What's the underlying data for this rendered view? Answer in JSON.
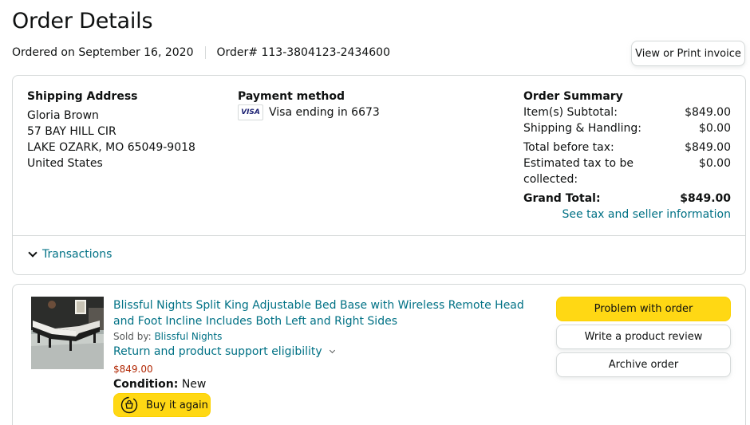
{
  "page": {
    "title": "Order Details",
    "ordered_on": "Ordered on September 16, 2020",
    "order_number": "Order# 113-3804123-2434600",
    "invoice_button": "View or Print invoice"
  },
  "shipping": {
    "title": "Shipping Address",
    "name": "Gloria Brown",
    "street": "57 BAY HILL CIR",
    "city": "LAKE OZARK, MO 65049-9018",
    "country": "United States"
  },
  "payment": {
    "title": "Payment method",
    "card_brand": "VISA",
    "card_text": "Visa ending in 6673"
  },
  "order_summary": {
    "title": "Order Summary",
    "rows": [
      {
        "label": "Item(s) Subtotal:",
        "value": "$849.00"
      },
      {
        "label": "Shipping & Handling:",
        "value": "$0.00"
      },
      {
        "label": "Total before tax:",
        "value": "$849.00"
      },
      {
        "label": "Estimated tax to be collected:",
        "value": "$0.00"
      }
    ],
    "grand_total_label": "Grand Total:",
    "grand_total_value": "$849.00",
    "tax_link": "See tax and seller information"
  },
  "transactions": {
    "label": "Transactions",
    "icon": "chevron-down-icon"
  },
  "item": {
    "title": "Blissful Nights Split King Adjustable Bed Base with Wireless Remote Head and Foot Incline Includes Both Left and Right Sides",
    "sold_by_label": "Sold by:",
    "seller": "Blissful Nights",
    "return_link": "Return and product support eligibility",
    "price": "$849.00",
    "condition_label": "Condition:",
    "condition_value": "New",
    "buy_again": "Buy it again"
  },
  "actions": {
    "problem": "Problem with order",
    "review": "Write a product review",
    "archive": "Archive order"
  },
  "colors": {
    "link": "#007185",
    "price": "#b12704",
    "primary_button": "#ffd814",
    "border": "#d5d9d9"
  }
}
